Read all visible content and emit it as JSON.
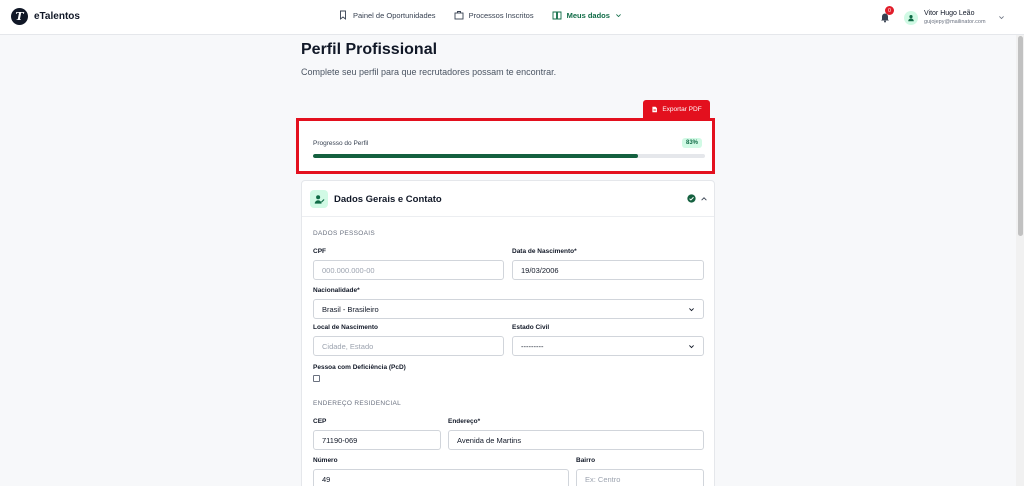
{
  "app": {
    "name": "eTalentos",
    "logo_letter": "T"
  },
  "nav": {
    "items": [
      {
        "label": "Painel de Oportunidades",
        "icon": "bookmark-icon"
      },
      {
        "label": "Processos Inscritos",
        "icon": "briefcase-icon"
      },
      {
        "label": "Meus dados",
        "icon": "book-icon",
        "active": true
      }
    ]
  },
  "notifications": {
    "count": "0"
  },
  "user": {
    "name": "Vitor Hugo Leão",
    "email": "gujojepy@mailinator.com"
  },
  "page": {
    "title": "Perfil Profissional",
    "subtitle": "Complete seu perfil para que recrutadores possam te encontrar."
  },
  "export": {
    "label": "Exportar PDF"
  },
  "progress": {
    "label": "Progresso do Perfil",
    "percent_text": "83%",
    "value": 0.83
  },
  "section": {
    "title": "Dados Gerais e Contato",
    "personal_group": "DADOS PESSOAIS",
    "address_group": "ENDEREÇO RESIDENCIAL"
  },
  "fields": {
    "cpf": {
      "label": "CPF",
      "value": "",
      "placeholder": "000.000.000-00"
    },
    "birth": {
      "label": "Data de Nascimento*",
      "value": "19/03/2006"
    },
    "nationality": {
      "label": "Nacionalidade*",
      "value": "Brasil - Brasileiro"
    },
    "birthplace": {
      "label": "Local de Nascimento",
      "value": "",
      "placeholder": "Cidade, Estado"
    },
    "marital": {
      "label": "Estado Civil",
      "value": "---------"
    },
    "pcd": {
      "label": "Pessoa com Deficiência (PcD)",
      "checked": false
    },
    "cep": {
      "label": "CEP",
      "value": "71190-069"
    },
    "address": {
      "label": "Endereço*",
      "value": "Avenida de Martins"
    },
    "number": {
      "label": "Número",
      "value": "49"
    },
    "district": {
      "label": "Bairro",
      "value": "",
      "placeholder": "Ex: Centro"
    }
  },
  "colors": {
    "brand": "#0f6b46",
    "accent_red": "#e3101e",
    "progress_fill": "#14603f"
  }
}
